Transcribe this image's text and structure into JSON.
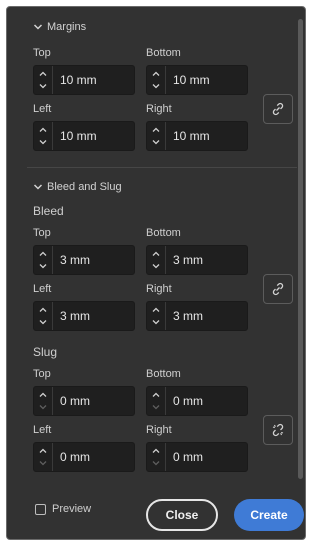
{
  "colors": {
    "panel_bg": "#323232",
    "field_bg": "#1f1f1f",
    "accent": "#3f7bd6"
  },
  "margins": {
    "header": "Margins",
    "top_label": "Top",
    "bottom_label": "Bottom",
    "left_label": "Left",
    "right_label": "Right",
    "top": "10 mm",
    "bottom": "10 mm",
    "left": "10 mm",
    "right": "10 mm",
    "link_icon": "chain-link-icon"
  },
  "bleed_slug": {
    "header": "Bleed and Slug",
    "bleed": {
      "label": "Bleed",
      "top_label": "Top",
      "bottom_label": "Bottom",
      "left_label": "Left",
      "right_label": "Right",
      "top": "3 mm",
      "bottom": "3 mm",
      "left": "3 mm",
      "right": "3 mm",
      "link_icon": "chain-link-icon"
    },
    "slug": {
      "label": "Slug",
      "top_label": "Top",
      "bottom_label": "Bottom",
      "left_label": "Left",
      "right_label": "Right",
      "top": "0 mm",
      "bottom": "0 mm",
      "left": "0 mm",
      "right": "0 mm",
      "link_icon": "broken-chain-link-icon"
    }
  },
  "footer": {
    "preview_label": "Preview",
    "close_label": "Close",
    "create_label": "Create"
  }
}
